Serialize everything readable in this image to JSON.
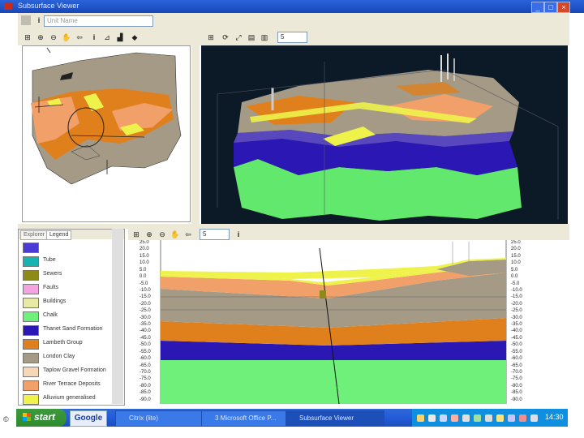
{
  "app": {
    "title": "Subsurface Viewer",
    "window_controls": [
      "_",
      "□",
      "×"
    ]
  },
  "toolbar": {
    "unit_combo_value": "Unit Name",
    "info_label": "i"
  },
  "view_toolbar": {
    "left_combo_value": "",
    "right_combo_value": "5"
  },
  "legend": {
    "tabs": [
      "Explorer",
      "Legend"
    ],
    "items": [
      {
        "label": "",
        "color": "#4b3bd6"
      },
      {
        "label": "Tube",
        "color": "#17b3b3"
      },
      {
        "label": "Sewers",
        "color": "#8f8a17"
      },
      {
        "label": "Faults",
        "color": "#f4a3e0"
      },
      {
        "label": "Buildings",
        "color": "#e9e9a6"
      },
      {
        "label": "Chalk",
        "color": "#6ef07a"
      },
      {
        "label": "Thanet Sand Formation",
        "color": "#2a17b4"
      },
      {
        "label": "Lambeth Group",
        "color": "#e0801c"
      },
      {
        "label": "London Clay",
        "color": "#a49a86"
      },
      {
        "label": "Taplow Gravel Formation",
        "color": "#f7d7b5"
      },
      {
        "label": "River Terrace Deposits",
        "color": "#f2a06a"
      },
      {
        "label": "Alluvium generalised",
        "color": "#eef24a"
      }
    ]
  },
  "section": {
    "combo_value": "5",
    "left_axis": [
      "25.0",
      "20.0",
      "15.0",
      "10.0",
      "5.0",
      "0.0",
      "-5.0",
      "-10.0",
      "-15.0",
      "-20.0",
      "-25.0",
      "-30.0",
      "-35.0",
      "-40.0",
      "-45.0",
      "-50.0",
      "-55.0",
      "-60.0",
      "-65.0",
      "-70.0",
      "-75.0",
      "-80.0",
      "-85.0",
      "-90.0"
    ],
    "right_axis": [
      "25.0",
      "20.0",
      "15.0",
      "10.0",
      "5.0",
      "0.0",
      "-5.0",
      "-10.0",
      "-15.0",
      "-20.0",
      "-25.0",
      "-30.0",
      "-35.0",
      "-40.0",
      "-45.0",
      "-50.0",
      "-55.0",
      "-60.0",
      "-65.0",
      "-70.0",
      "-75.0",
      "-80.0",
      "-85.0",
      "-90.0"
    ]
  },
  "taskbar": {
    "start_label": "start",
    "search_label": "Google",
    "tasks": [
      "Citrix (lite)",
      "3 Microsoft Office P...",
      "Subsurface Viewer"
    ],
    "clock": "14:30"
  },
  "slide": {
    "copyright": "©"
  },
  "colors": {
    "chalk": "#6ef07a",
    "thanet": "#2a17b4",
    "lambeth": "#e0801c",
    "london_clay": "#a49a86",
    "terrace": "#f2a06a",
    "alluvium": "#eef24a",
    "xp_blue": "#245edb"
  }
}
